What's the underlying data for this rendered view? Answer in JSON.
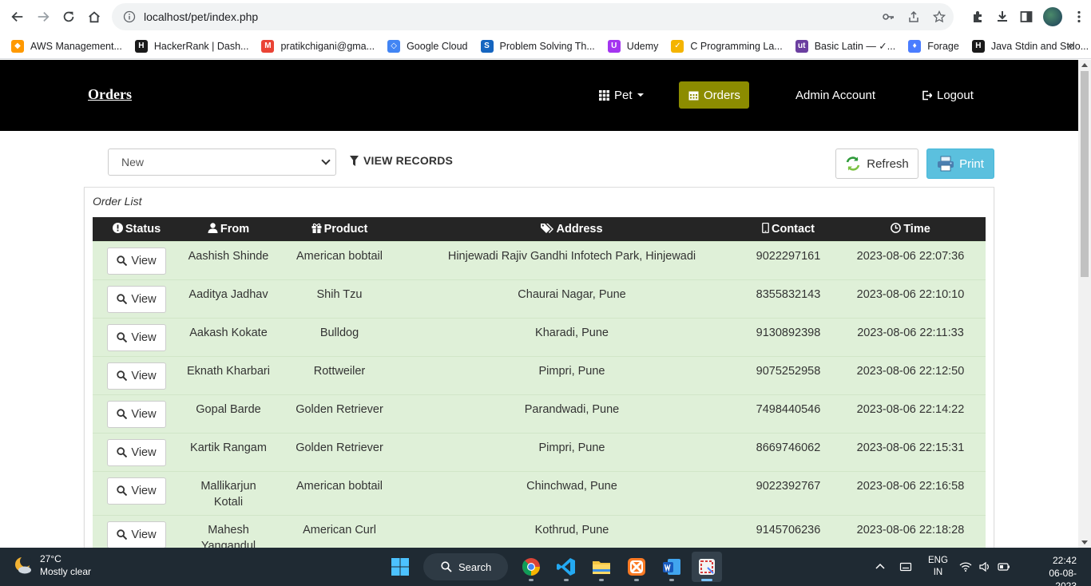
{
  "browser": {
    "url": "localhost/pet/index.php",
    "bookmarks": [
      {
        "label": "AWS Management...",
        "color": "#ff9900",
        "glyph": "◆"
      },
      {
        "label": "HackerRank | Dash...",
        "color": "#1a1a1a",
        "glyph": "H"
      },
      {
        "label": "pratikchigani@gma...",
        "color": "#ea4335",
        "glyph": "M"
      },
      {
        "label": "Google Cloud",
        "color": "#4285f4",
        "glyph": "◇"
      },
      {
        "label": "Problem Solving Th...",
        "color": "#1565c0",
        "glyph": "S"
      },
      {
        "label": "Udemy",
        "color": "#a435f0",
        "glyph": "U"
      },
      {
        "label": "C Programming La...",
        "color": "#f4b400",
        "glyph": "✓"
      },
      {
        "label": "Basic Latin — ✓...",
        "color": "#6b3fa0",
        "glyph": "ut"
      },
      {
        "label": "Forage",
        "color": "#4a7dff",
        "glyph": "♦"
      },
      {
        "label": "Java Stdin and Stdo...",
        "color": "#1a1a1a",
        "glyph": "H"
      }
    ]
  },
  "navbar": {
    "brand": "Orders",
    "pet": "Pet",
    "orders": "Orders",
    "admin": "Admin Account",
    "logout": "Logout"
  },
  "filter": {
    "selected": "New",
    "view_records": "VIEW RECORDS"
  },
  "actions": {
    "refresh": "Refresh",
    "print": "Print"
  },
  "panel": {
    "title": "Order List"
  },
  "table": {
    "headers": {
      "status": "Status",
      "from": "From",
      "product": "Product",
      "address": "Address",
      "contact": "Contact",
      "time": "Time"
    },
    "view_label": "View",
    "rows": [
      {
        "from": "Aashish Shinde",
        "product": "American bobtail",
        "address": "Hinjewadi Rajiv Gandhi Infotech Park, Hinjewadi",
        "contact": "9022297161",
        "time": "2023-08-06 22:07:36"
      },
      {
        "from": "Aaditya Jadhav",
        "product": "Shih Tzu",
        "address": "Chaurai Nagar, Pune",
        "contact": "8355832143",
        "time": "2023-08-06 22:10:10"
      },
      {
        "from": "Aakash Kokate",
        "product": "Bulldog",
        "address": "Kharadi, Pune",
        "contact": "9130892398",
        "time": "2023-08-06 22:11:33"
      },
      {
        "from": "Eknath Kharbari",
        "product": "Rottweiler",
        "address": "Pimpri, Pune",
        "contact": "9075252958",
        "time": "2023-08-06 22:12:50"
      },
      {
        "from": "Gopal Barde",
        "product": "Golden Retriever",
        "address": "Parandwadi, Pune",
        "contact": "7498440546",
        "time": "2023-08-06 22:14:22"
      },
      {
        "from": "Kartik Rangam",
        "product": "Golden Retriever",
        "address": "Pimpri, Pune",
        "contact": "8669746062",
        "time": "2023-08-06 22:15:31"
      },
      {
        "from": "Mallikarjun Kotali",
        "product": "American bobtail",
        "address": "Chinchwad, Pune",
        "contact": "9022392767",
        "time": "2023-08-06 22:16:58"
      },
      {
        "from": "Mahesh Yangandul",
        "product": "American Curl",
        "address": "Kothrud, Pune",
        "contact": "9145706236",
        "time": "2023-08-06 22:18:28"
      },
      {
        "from": "",
        "product": "",
        "address": "",
        "contact": "",
        "time": ""
      }
    ]
  },
  "taskbar": {
    "temp": "27°C",
    "weather": "Mostly clear",
    "search": "Search",
    "lang": "ENG",
    "region": "IN",
    "time": "22:42",
    "date": "06-08-2023"
  }
}
